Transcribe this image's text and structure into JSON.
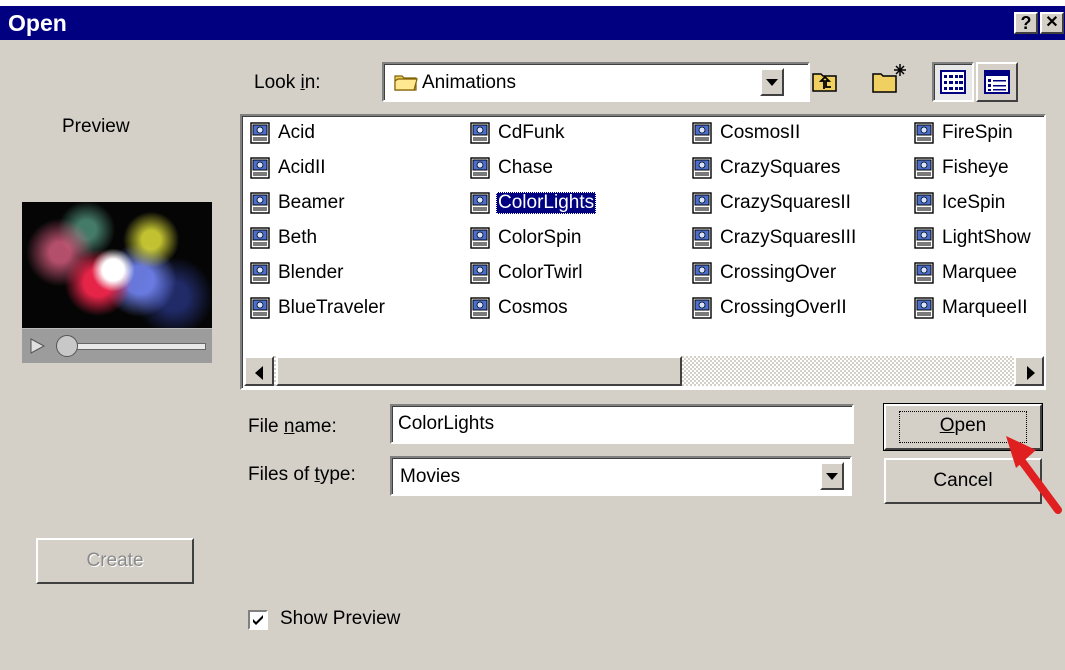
{
  "dialog": {
    "title": "Open",
    "help_button": "?",
    "close_button": "✕"
  },
  "look_in": {
    "label": "Look in:",
    "value": "Animations"
  },
  "toolbar": {
    "up_folder": "up-one-level",
    "new_folder": "create-new-folder",
    "list_view": "list-view",
    "details_view": "details-view"
  },
  "preview": {
    "label": "Preview"
  },
  "files": {
    "items": [
      {
        "name": "Acid"
      },
      {
        "name": "AcidII"
      },
      {
        "name": "Beamer"
      },
      {
        "name": "Beth"
      },
      {
        "name": "Blender"
      },
      {
        "name": "BlueTraveler"
      },
      {
        "name": "CdFunk"
      },
      {
        "name": "Chase"
      },
      {
        "name": "ColorLights"
      },
      {
        "name": "ColorSpin"
      },
      {
        "name": "ColorTwirl"
      },
      {
        "name": "Cosmos"
      },
      {
        "name": "CosmosII"
      },
      {
        "name": "CrazySquares"
      },
      {
        "name": "CrazySquaresII"
      },
      {
        "name": "CrazySquaresIII"
      },
      {
        "name": "CrossingOver"
      },
      {
        "name": "CrossingOverII"
      },
      {
        "name": "FireSpin"
      },
      {
        "name": "Fisheye"
      },
      {
        "name": "IceSpin"
      },
      {
        "name": "LightShow"
      },
      {
        "name": "Marquee"
      },
      {
        "name": "MarqueeII"
      }
    ],
    "selected": "ColorLights"
  },
  "file_name": {
    "label_pre": "File ",
    "label_u": "n",
    "label_post": "ame:",
    "value": "ColorLights"
  },
  "file_type": {
    "label_pre": "Files of ",
    "label_u": "t",
    "label_post": "ype:",
    "value": "Movies"
  },
  "buttons": {
    "open_u": "O",
    "open_rest": "pen",
    "cancel": "Cancel",
    "create": "Create"
  },
  "show_preview": {
    "label": "Show Preview",
    "checked": true
  },
  "colors": {
    "titlebar": "#000080",
    "face": "#d4d0c8",
    "selection": "#000080",
    "annotation_arrow": "#e02020"
  }
}
